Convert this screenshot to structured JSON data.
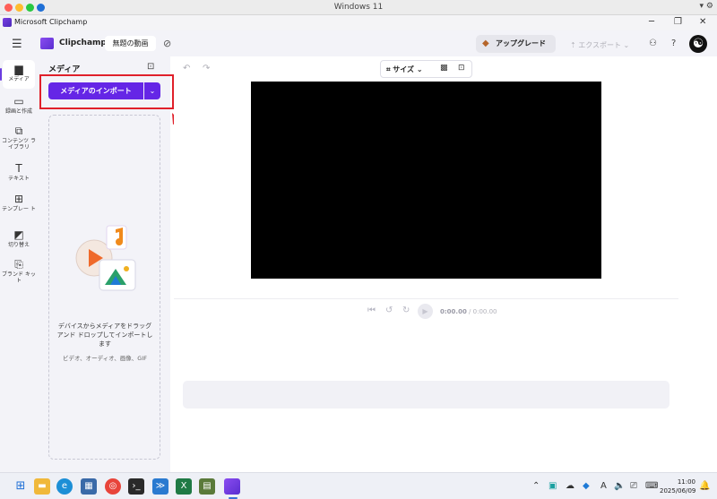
{
  "host": {
    "title": "Windows 11",
    "right_glyphs": "▾ ⚙"
  },
  "app": {
    "name": "Microsoft Clipchamp",
    "controls": [
      "─",
      "❐",
      "✕"
    ]
  },
  "header": {
    "brand": "Clipchamp",
    "project_name": "無題の動画",
    "upgrade_label": "アップグレード",
    "export_label": "エクスポート",
    "help_label": "?"
  },
  "rail": {
    "items": [
      {
        "label": "メディア",
        "icon": "folder-icon"
      },
      {
        "label": "録画と作成",
        "icon": "record-icon"
      },
      {
        "label": "コンテンツ ライブラリ",
        "icon": "library-icon"
      },
      {
        "label": "テキスト",
        "icon": "text-icon"
      },
      {
        "label": "テンプレー ト",
        "icon": "template-icon"
      },
      {
        "label": "切り替え",
        "icon": "transition-icon"
      },
      {
        "label": "ブランド キット",
        "icon": "brand-icon"
      }
    ]
  },
  "panel": {
    "title": "メディア",
    "import_label": "メディアのインポート",
    "drop_text": "デバイスからメディアをドラッグ アンド ドロップしてインポートします",
    "drop_sub": "ビデオ、オーディオ、画像、GIF"
  },
  "preview": {
    "size_label": "サイズ",
    "time_current": "0:00.00",
    "time_total": "/ 0:00.00"
  },
  "taskbar": {
    "time": "11:00",
    "date": "2025/06/09",
    "ime": "A"
  },
  "colors": {
    "accent": "#6526e6",
    "highlight": "#e0202a",
    "canvas": "#000000"
  }
}
